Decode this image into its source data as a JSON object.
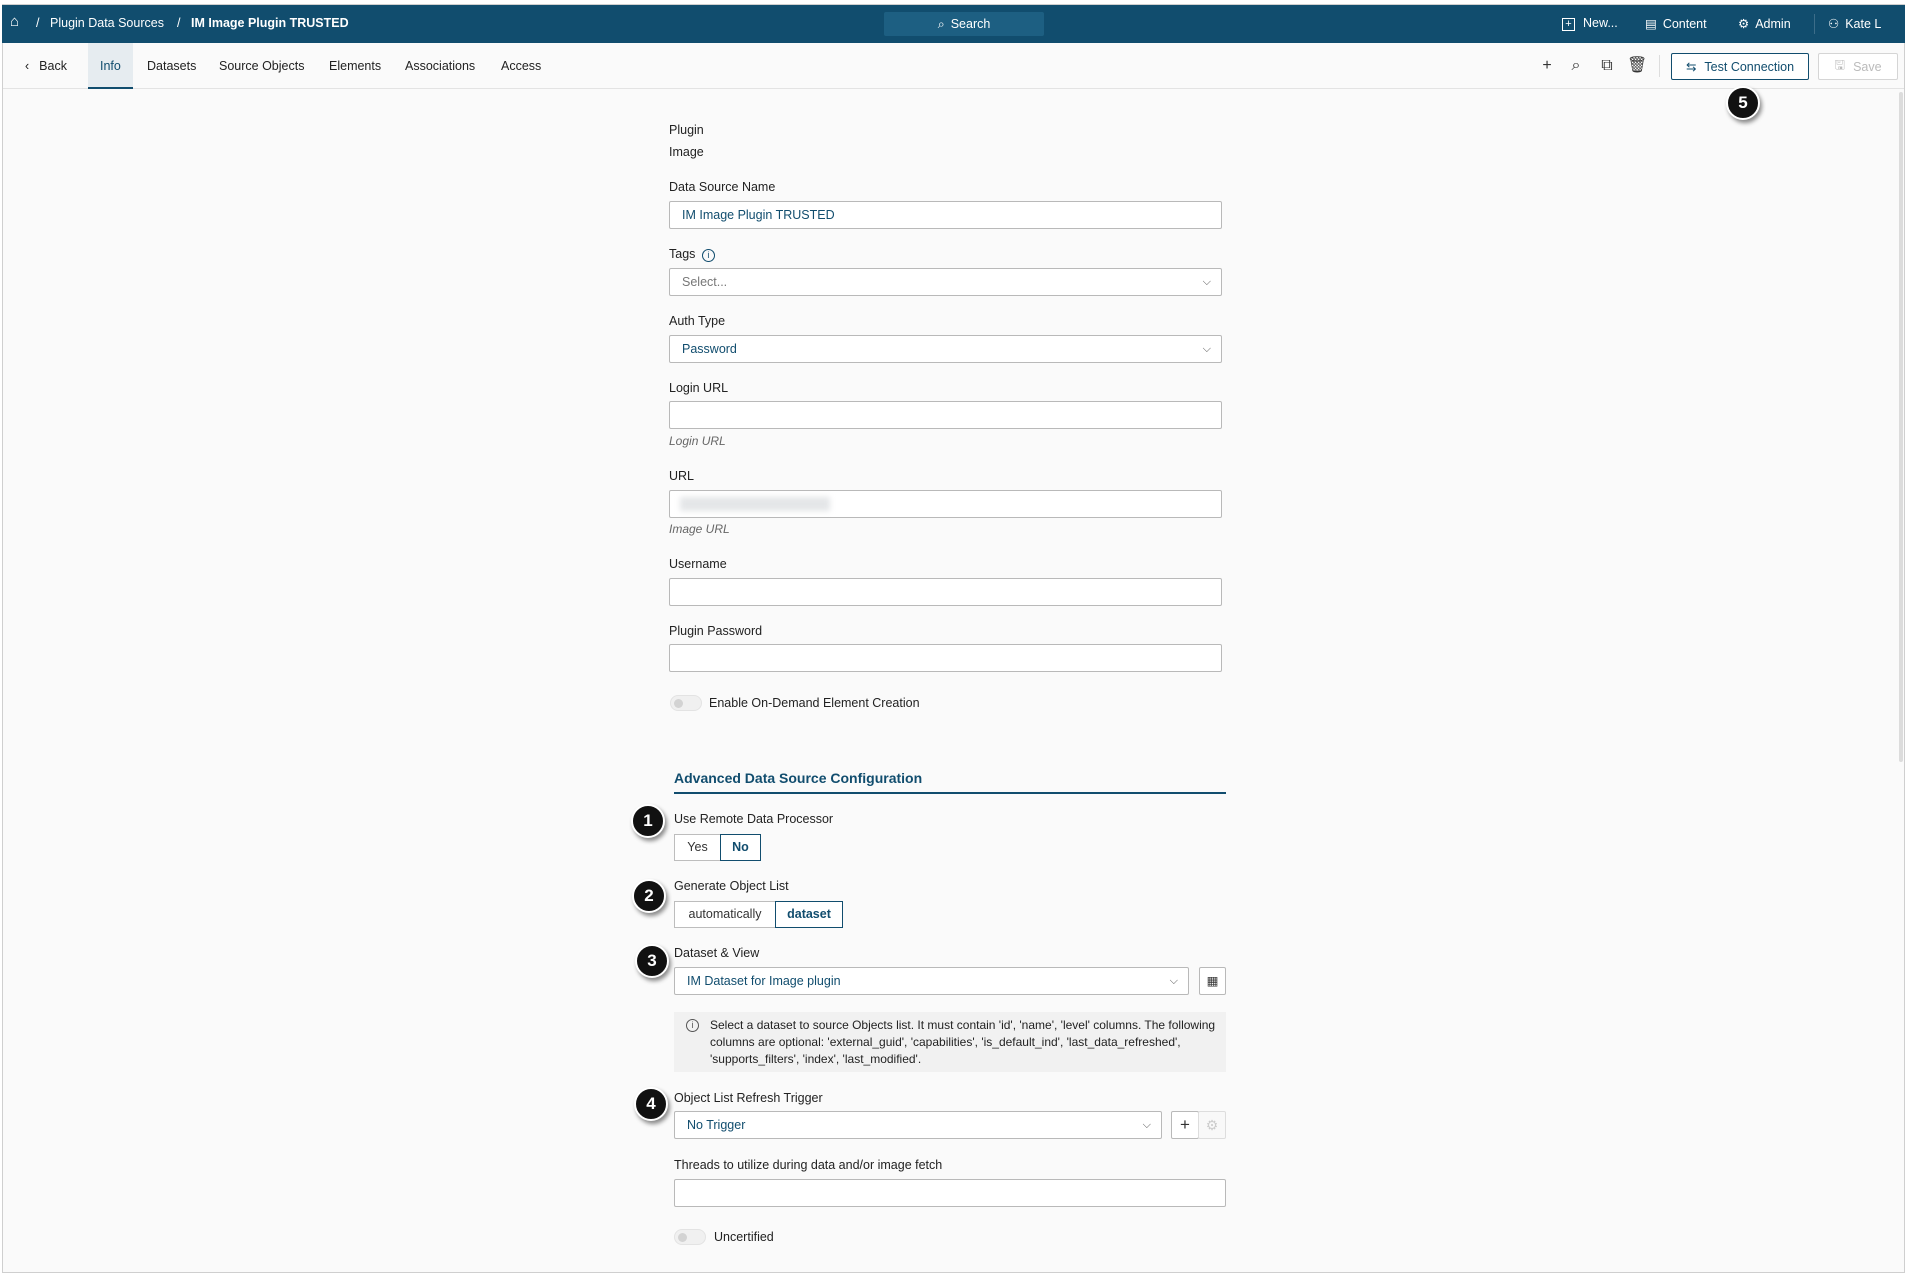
{
  "header": {
    "breadcrumb": [
      "Plugin Data Sources",
      "IM Image Plugin TRUSTED"
    ],
    "search_label": "Search",
    "new_label": "New...",
    "content_label": "Content",
    "admin_label": "Admin",
    "user_label": "Kate L"
  },
  "tabs": {
    "back": "Back",
    "items": [
      "Info",
      "Datasets",
      "Source Objects",
      "Elements",
      "Associations",
      "Access"
    ],
    "active": "Info"
  },
  "toolbar": {
    "test_connection": "Test Connection",
    "save": "Save"
  },
  "callouts": [
    "1",
    "2",
    "3",
    "4",
    "5"
  ],
  "form": {
    "plugin_label": "Plugin",
    "plugin_value": "Image",
    "name_label": "Data Source Name",
    "name_value": "IM Image Plugin TRUSTED",
    "tags_label": "Tags",
    "tags_placeholder": "Select...",
    "auth_label": "Auth Type",
    "auth_value": "Password",
    "login_url_label": "Login URL",
    "login_url_hint": "Login URL",
    "url_label": "URL",
    "url_hint": "Image URL",
    "username_label": "Username",
    "password_label": "Plugin Password",
    "on_demand_label": "Enable On-Demand Element Creation"
  },
  "advanced": {
    "title": "Advanced Data Source Configuration",
    "remote_label": "Use Remote Data Processor",
    "remote_options": [
      "Yes",
      "No"
    ],
    "remote_selected": "No",
    "generate_label": "Generate Object List",
    "generate_options": [
      "automatically",
      "dataset"
    ],
    "generate_selected": "dataset",
    "dataset_label": "Dataset & View",
    "dataset_value": "IM Dataset for Image plugin",
    "info_text": "Select a dataset to source Objects list. It must contain 'id', 'name', 'level' columns. The following columns are optional: 'external_guid', 'capabilities', 'is_default_ind', 'last_data_refreshed', 'supports_filters', 'index', 'last_modified'.",
    "trigger_label": "Object List Refresh Trigger",
    "trigger_value": "No Trigger",
    "threads_label": "Threads to utilize during data and/or image fetch",
    "uncertified_label": "Uncertified"
  }
}
